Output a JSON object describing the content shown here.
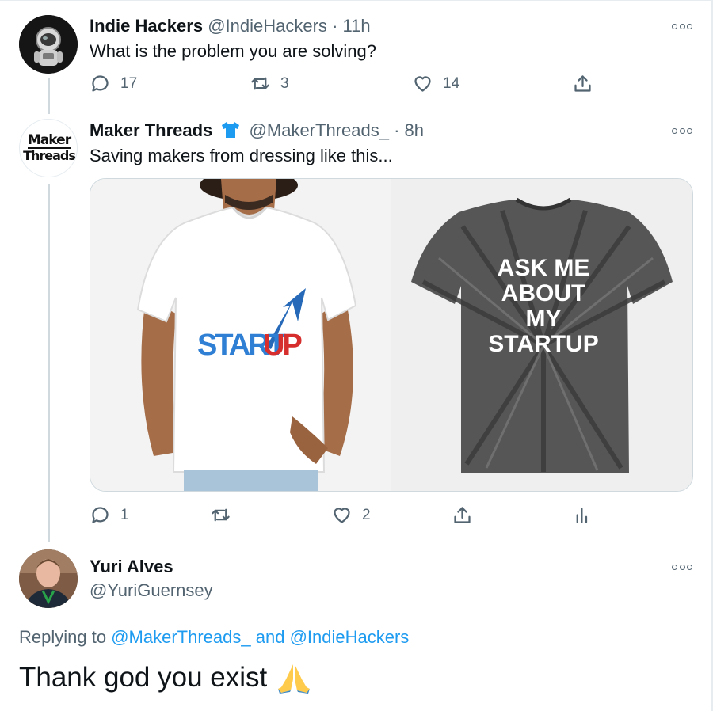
{
  "tweet1": {
    "name": "Indie Hackers",
    "handle": "@IndieHackers",
    "separator": "·",
    "time": "11h",
    "text": "What is the problem you are solving?",
    "replies": "17",
    "retweets": "3",
    "likes": "14",
    "avatar_icon": "astronaut-avatar"
  },
  "tweet2": {
    "name": "Maker Threads",
    "badge_icon": "tshirt-icon",
    "handle": "@MakerThreads_",
    "separator": "·",
    "time": "8h",
    "text": "Saving makers from dressing like this...",
    "avatar_logo_line1": "Maker",
    "avatar_logo_line2": "Threads",
    "replies": "1",
    "retweets": "",
    "likes": "2",
    "media": {
      "left_shirt_text_a": "START",
      "left_shirt_text_b": "UP",
      "right_shirt_lines": [
        "ASK ME",
        "ABOUT",
        "MY",
        "STARTUP"
      ]
    }
  },
  "reply": {
    "name": "Yuri Alves",
    "handle": "@YuriGuernsey",
    "replying_prefix": "Replying to",
    "replying_user1": "@MakerThreads_",
    "replying_and": "and",
    "replying_user2": "@IndieHackers",
    "text": "Thank god you exist",
    "emoji": "🙏"
  },
  "colors": {
    "link": "#1d9bf0",
    "secondary_text": "#536471",
    "primary_text": "#0f1419",
    "tshirt_badge": "#1d9bf0",
    "startup_blue": "#2f7fd4",
    "startup_red": "#d62d2d"
  }
}
